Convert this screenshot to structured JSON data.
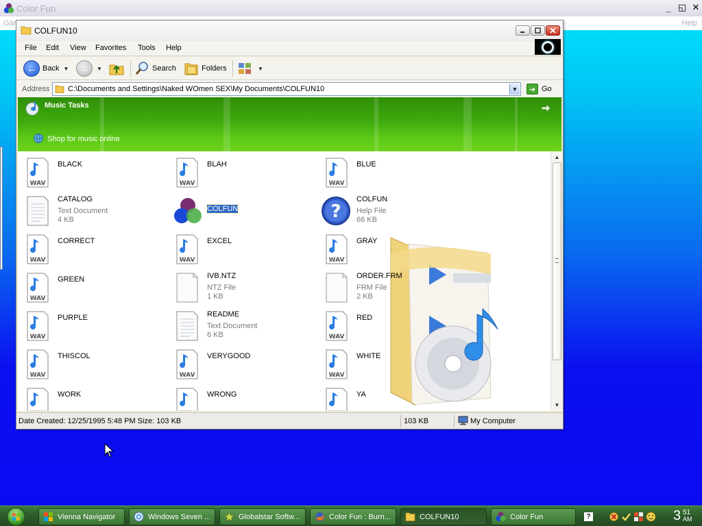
{
  "background_app": {
    "title": "Color Fun",
    "menu_left": "Gam",
    "menu_right": "Help",
    "controls": [
      "_",
      "◱",
      "✕"
    ]
  },
  "window": {
    "title": "COLFUN10",
    "menu": [
      "File",
      "Edit",
      "View",
      "Favorites",
      "Tools",
      "Help"
    ],
    "toolbar": {
      "back": "Back",
      "search": "Search",
      "folders": "Folders"
    },
    "address": {
      "label": "Address",
      "path": "C:\\Documents and Settings\\Naked WOmen SEX\\My Documents\\COLFUN10",
      "go": "Go"
    },
    "tasks": {
      "title": "Music Tasks",
      "link": "Shop for music online"
    },
    "files": [
      {
        "name": "BLACK",
        "icon": "wav-icon"
      },
      {
        "name": "BLAH",
        "icon": "wav-icon"
      },
      {
        "name": "BLUE",
        "icon": "wav-icon"
      },
      {
        "name": "CATALOG",
        "type": "Text Document",
        "size": "4 KB",
        "icon": "text-document-icon"
      },
      {
        "name": "COLFUN",
        "icon": "colfun-app-icon",
        "selected": true
      },
      {
        "name": "COLFUN",
        "type": "Help File",
        "size": "66 KB",
        "icon": "help-file-icon"
      },
      {
        "name": "CORRECT",
        "icon": "wav-icon"
      },
      {
        "name": "EXCEL",
        "icon": "wav-icon"
      },
      {
        "name": "GRAY",
        "icon": "wav-icon"
      },
      {
        "name": "GREEN",
        "icon": "wav-icon"
      },
      {
        "name": "IVB.NTZ",
        "type": "NTZ File",
        "size": "1 KB",
        "icon": "blank-file-icon"
      },
      {
        "name": "ORDER.FRM",
        "type": "FRM File",
        "size": "2 KB",
        "icon": "blank-file-icon"
      },
      {
        "name": "PURPLE",
        "icon": "wav-icon"
      },
      {
        "name": "README",
        "type": "Text Document",
        "size": "6 KB",
        "icon": "text-document-icon"
      },
      {
        "name": "RED",
        "icon": "wav-icon"
      },
      {
        "name": "THISCOL",
        "icon": "wav-icon"
      },
      {
        "name": "VERYGOOD",
        "icon": "wav-icon"
      },
      {
        "name": "WHITE",
        "icon": "wav-icon"
      },
      {
        "name": "WORK",
        "icon": "wav-icon"
      },
      {
        "name": "WRONG",
        "icon": "wav-icon"
      },
      {
        "name": "YA",
        "icon": "wav-icon"
      }
    ],
    "wav_label": "WAV",
    "status": {
      "details": "Date Created: 12/25/1995 5:48 PM Size: 103 KB",
      "size": "103 KB",
      "zone": "My Computer"
    }
  },
  "taskbar": {
    "items": [
      {
        "label": "Vienna Navigator",
        "icon": "vienna-icon"
      },
      {
        "label": "Windows Seven ...",
        "icon": "ie-globe-icon"
      },
      {
        "label": "Globalstar Softw...",
        "icon": "star-icon"
      },
      {
        "label": "Color Fun : Burn...",
        "icon": "firefox-icon"
      },
      {
        "label": "COLFUN10",
        "icon": "folder-icon",
        "active": true
      },
      {
        "label": "Color Fun",
        "icon": "colfun-app-icon"
      }
    ],
    "clock": {
      "hour": "3",
      "minute": "51",
      "ampm": "AM"
    },
    "tray_help": "?"
  },
  "colors": {
    "desktop_top": "#00e6ff",
    "desktop_bottom": "#0b0af2",
    "task_pane_green": "#3fab0d",
    "selection_blue": "#316ac5",
    "taskbar_green": "#2d5c2a"
  }
}
